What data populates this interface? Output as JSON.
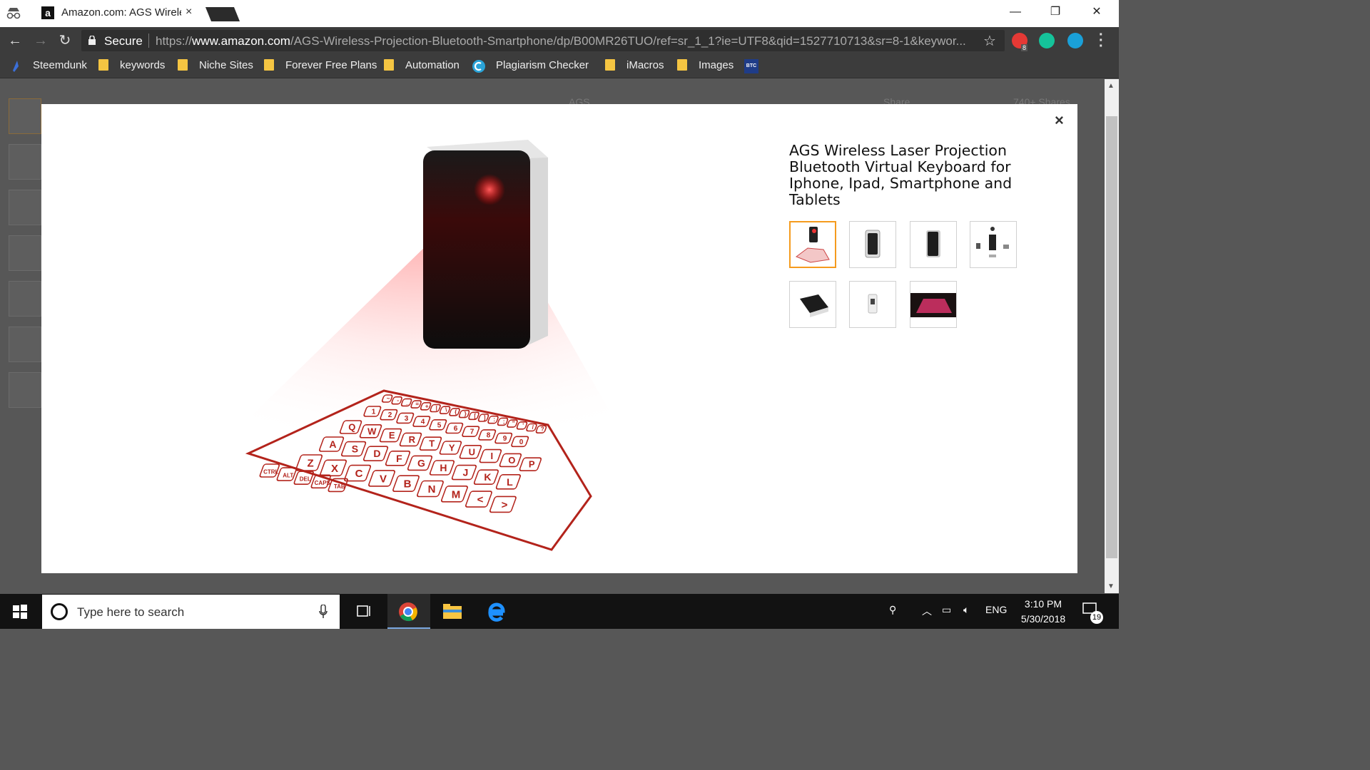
{
  "browser": {
    "tab_title": "Amazon.com: AGS Wirele",
    "tab_close": "×",
    "window_controls": [
      "—",
      "❐",
      "✕"
    ],
    "secure_label": "Secure",
    "url_scheme": "https://",
    "url_host": "www.amazon.com",
    "url_path": "/AGS-Wireless-Projection-Bluetooth-Smartphone/dp/B00MR26TUO/ref=sr_1_1?ie=UTF8&qid=1527710713&sr=8-1&keywor...",
    "extension_badge": "8"
  },
  "bookmarks": [
    {
      "label": "Steemdunk",
      "icon": "steemdunk-icon"
    },
    {
      "label": "keywords",
      "icon": "folder-icon"
    },
    {
      "label": "Niche Sites",
      "icon": "folder-icon"
    },
    {
      "label": "Forever Free Plans",
      "icon": "folder-icon"
    },
    {
      "label": "Automation",
      "icon": "folder-icon"
    },
    {
      "label": "Plagiarism Checker",
      "icon": "plagiarism-icon"
    },
    {
      "label": "iMacros",
      "icon": "folder-icon"
    },
    {
      "label": "Images",
      "icon": "folder-icon"
    }
  ],
  "bookmark_btc_label": "BTC",
  "page_bg": {
    "brand_fragment": "AGS",
    "share_fragment": "Share",
    "shares_count": "740+ Shares"
  },
  "modal": {
    "close_label": "×",
    "product_title": "AGS Wireless Laser Projection Bluetooth Virtual Keyboard for Iphone, Ipad, Smartphone and Tablets",
    "thumbnails": [
      {
        "name": "keyboard-projection",
        "selected": true
      },
      {
        "name": "device-front-white",
        "selected": false
      },
      {
        "name": "device-front-angled",
        "selected": false
      },
      {
        "name": "package-contents",
        "selected": false
      },
      {
        "name": "device-lying",
        "selected": false
      },
      {
        "name": "device-white-small",
        "selected": false
      },
      {
        "name": "keyboard-red-dark",
        "selected": false
      }
    ],
    "keyboard_rows": [
      [
        "~",
        "-",
        "_",
        "=",
        "+",
        "|",
        "\\",
        "{",
        "}",
        "[",
        "]",
        ":",
        ";",
        "\"",
        "'",
        "/",
        "?"
      ],
      [
        "1",
        "2",
        "3",
        "4",
        "5",
        "6",
        "7",
        "8",
        "9",
        "0"
      ],
      [
        "Q",
        "W",
        "E",
        "R",
        "T",
        "Y",
        "U",
        "I",
        "O",
        "P"
      ],
      [
        "A",
        "S",
        "D",
        "F",
        "G",
        "H",
        "J",
        "K",
        "L"
      ],
      [
        "Z",
        "X",
        "C",
        "V",
        "B",
        "N",
        "M",
        "<",
        ">"
      ],
      [
        "CTRL",
        "ALT",
        "DEL",
        "CAPS",
        "TAB"
      ]
    ]
  },
  "taskbar": {
    "search_placeholder": "Type here to search",
    "language": "ENG",
    "time": "3:10 PM",
    "date": "5/30/2018",
    "notification_count": "19"
  },
  "colors": {
    "accent_orange": "#f59b1e",
    "laser_red": "#b3231b",
    "chrome_dark": "#3c3c3c"
  }
}
